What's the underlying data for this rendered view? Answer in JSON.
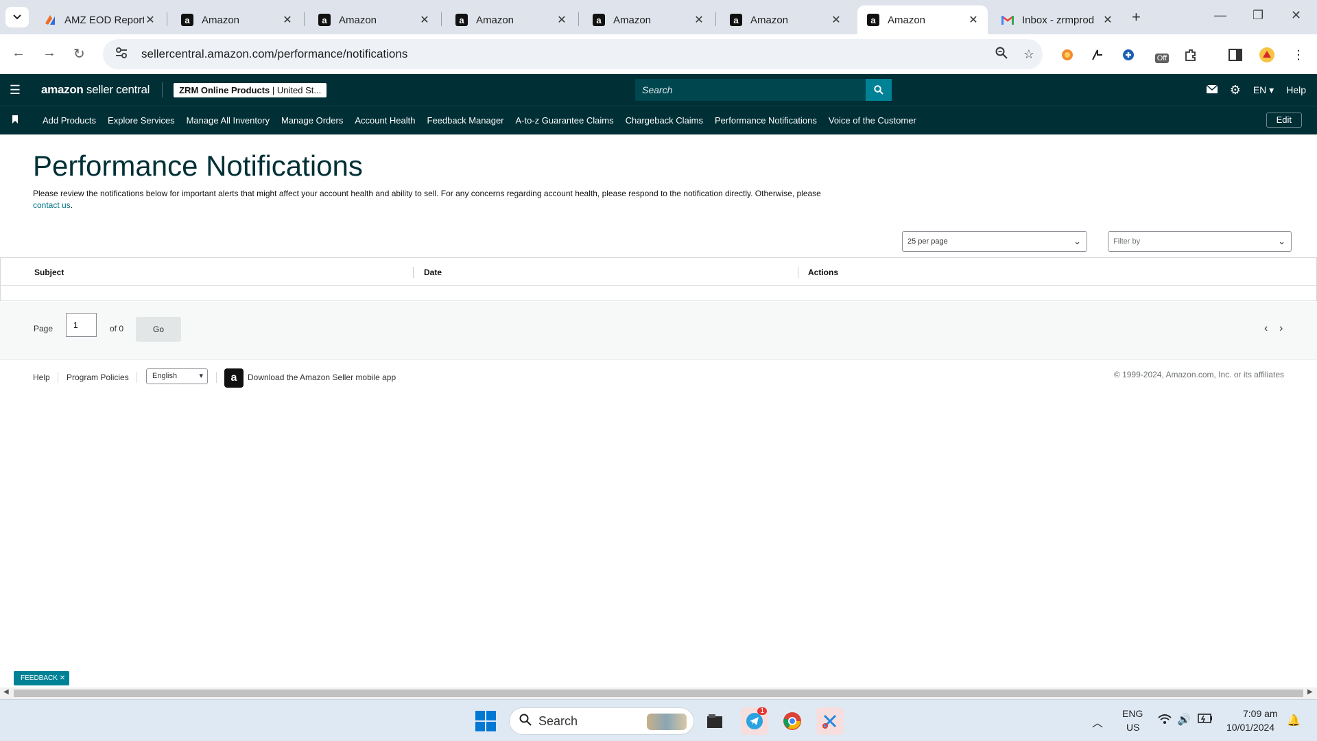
{
  "browser": {
    "tabs": [
      {
        "title": "AMZ EOD Report",
        "icon": "amz-eod-icon"
      },
      {
        "title": "Amazon",
        "icon": "amazon-icon"
      },
      {
        "title": "Amazon",
        "icon": "amazon-icon"
      },
      {
        "title": "Amazon",
        "icon": "amazon-icon"
      },
      {
        "title": "Amazon",
        "icon": "amazon-icon"
      },
      {
        "title": "Amazon",
        "icon": "amazon-icon"
      },
      {
        "title": "Amazon",
        "icon": "amazon-icon",
        "active": true
      },
      {
        "title": "Inbox - zrmprod",
        "icon": "gmail-icon"
      }
    ],
    "url": "sellercentral.amazon.com/performance/notifications",
    "extension_badge": "Off"
  },
  "header": {
    "logo_bold": "amazon",
    "logo_light": " seller central",
    "account_name": "ZRM Online Products",
    "account_region": " | United St...",
    "search_placeholder": "Search",
    "language": "EN",
    "help": "Help"
  },
  "nav": {
    "items": [
      "Add Products",
      "Explore Services",
      "Manage All Inventory",
      "Manage Orders",
      "Account Health",
      "Feedback Manager",
      "A-to-z Guarantee Claims",
      "Chargeback Claims",
      "Performance Notifications",
      "Voice of the Customer"
    ],
    "edit": "Edit"
  },
  "main": {
    "title": "Performance Notifications",
    "intro": "Please review the notifications below for important alerts that might affect your account health and ability to sell. For any concerns regarding account health, please respond to the notification directly. Otherwise, please ",
    "contact_link": "contact us",
    "per_page": "25 per page",
    "filter_placeholder": "Filter by",
    "columns": [
      "Subject",
      "Date",
      "Actions"
    ],
    "pager": {
      "page_label": "Page",
      "page_value": "1",
      "of_label": "of 0",
      "go": "Go"
    }
  },
  "footer": {
    "help": "Help",
    "program_policies": "Program Policies",
    "language": "English",
    "app_text": "Download the Amazon Seller mobile app",
    "copyright": "© 1999-2024, Amazon.com, Inc. or its affiliates"
  },
  "feedback": "FEEDBACK",
  "taskbar": {
    "search": "Search",
    "telegram_badge": "1",
    "lang_top": "ENG",
    "lang_bottom": "US",
    "time": "7:09 am",
    "date": "10/01/2024"
  },
  "colors": {
    "header_bg": "#002f36",
    "accent": "#008296",
    "link": "#007185"
  }
}
